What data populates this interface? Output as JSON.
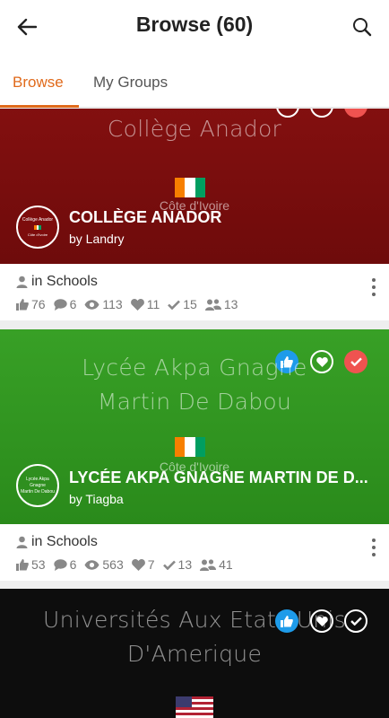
{
  "header": {
    "title": "Browse (60)",
    "back_icon": "arrow-left-icon",
    "search_icon": "search-icon"
  },
  "tabs": [
    {
      "label": "Browse",
      "active": true
    },
    {
      "label": "My Groups",
      "active": false
    }
  ],
  "colors": {
    "accent": "#e06a1b",
    "like_blue": "#1e9be9",
    "check_red": "#ef5350"
  },
  "groups": [
    {
      "banner_lines": [
        "Collège Anador"
      ],
      "country": "Côte d'Ivoire",
      "name": "COLLÈGE ANADOR",
      "author": "by Landry",
      "logo_lines": [
        "Collège Anador"
      ],
      "logo_country": "Côte d'Ivoire",
      "category": "in Schools",
      "stats": {
        "likes": "76",
        "comments": "6",
        "views": "113",
        "favorites": "11",
        "checks": "15",
        "members": "13"
      },
      "banner_color": "#7d0c0c"
    },
    {
      "banner_lines": [
        "Lycée Akpa Gnagne",
        "Martin De Dabou"
      ],
      "country": "Côte d'Ivoire",
      "name": "LYCÉE AKPA GNAGNE MARTIN DE D...",
      "author": "by Tiagba",
      "logo_lines": [
        "Lycée Akpa Gnagne",
        "Martin De Dabou"
      ],
      "category": "in Schools",
      "stats": {
        "likes": "53",
        "comments": "6",
        "views": "563",
        "favorites": "7",
        "checks": "13",
        "members": "41"
      },
      "banner_color": "#2f8f1f"
    },
    {
      "banner_lines": [
        "Universités Aux Etats-Unis",
        "D'Amerique"
      ],
      "banner_color": "#0d0d0d"
    }
  ]
}
